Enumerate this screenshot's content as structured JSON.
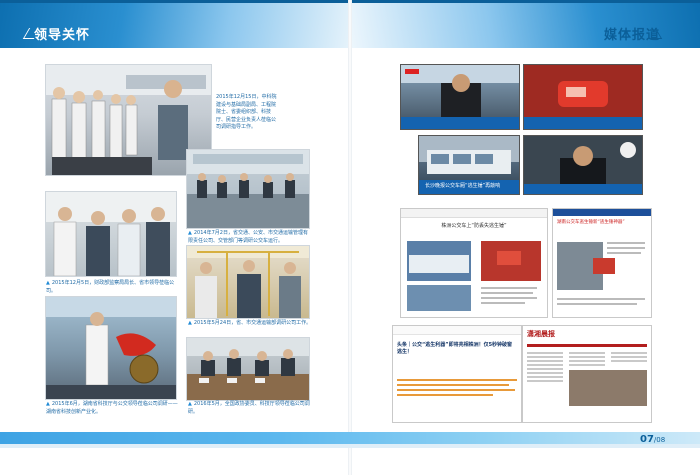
{
  "header": {
    "left_title": "领导关怀",
    "right_title": "媒体报道"
  },
  "captions": {
    "c1": "2015年12月15日，中科院建设与基础局副局、工程院院士、省委组织部、科技厅、民营企业负责人莅临公司调研指导工作。",
    "c2": "2014年7月2日，省交通、公安、市交通运输管理有限责任公司、交管部门等调研公交车运行。",
    "c3": "2015年12月5日，财政部监察局局长、省市领导莅临公司。",
    "c4": "2015年5月24日，省、市交通运输部调研公司工作。",
    "c5": "2015年6月，湖南省科技厅与公交领导莅临公司调研——湖南省科技创新产业化。",
    "c6": "2016年5月，全国政协委员、科技厅领导莅临公司调研。"
  },
  "media": {
    "tv_bottom_caption": "长沙晚报公交车厢“逃生锤”再敲响",
    "web1_title": "株洲公交车上“防丢失逃生锤”",
    "web2_title": "湖南公交车逃生锤新“逃生锤神器”",
    "web3_headline": "头条｜公交“逃生利器”即将亮相株洲！仅5秒钟破窗逃生！",
    "paper_name": "潇湘晨报"
  },
  "footer": {
    "page": "07",
    "page_next": "/08"
  }
}
